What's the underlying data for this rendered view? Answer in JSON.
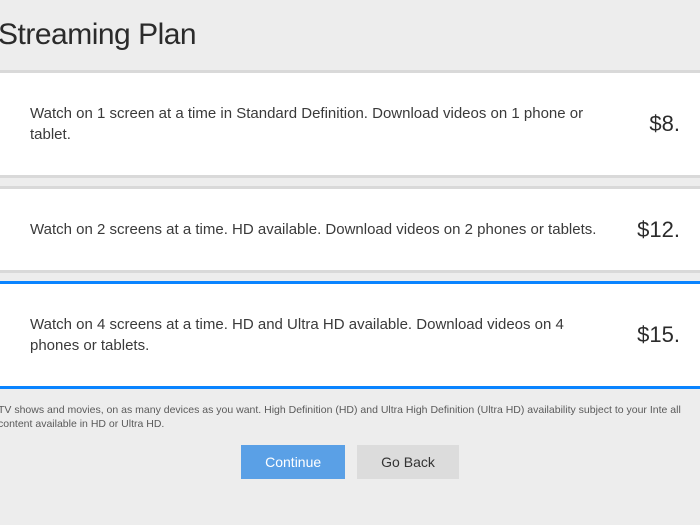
{
  "title": "Streaming Plan",
  "plans": [
    {
      "description": "Watch on 1 screen at a time in Standard Definition. Download videos on 1 phone or tablet.",
      "price": "$8.",
      "selected": false
    },
    {
      "description": "Watch on 2 screens at a time. HD available. Download videos on 2 phones or tablets.",
      "price": "$12.",
      "selected": false
    },
    {
      "description": "Watch on 4 screens at a time. HD and Ultra HD available. Download videos on 4 phones or tablets.",
      "price": "$15.",
      "selected": true
    }
  ],
  "disclaimer": "TV shows and movies, on as many devices as you want. High Definition (HD) and Ultra High Definition (Ultra HD) availability subject to your Inte all content available in HD or Ultra HD.",
  "buttons": {
    "continue": "Continue",
    "goback": "Go Back"
  }
}
